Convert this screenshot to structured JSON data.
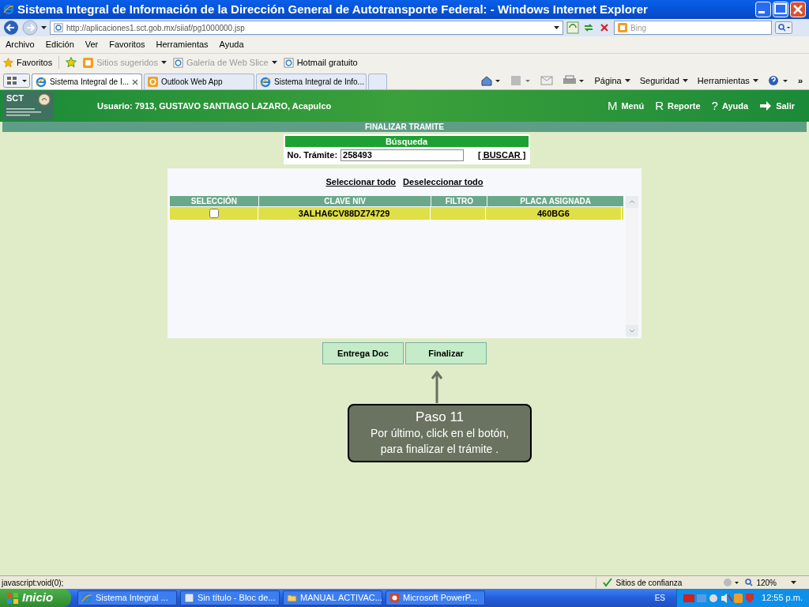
{
  "window": {
    "title": "Sistema Integral de Información de la Dirección General de Autotransporte Federal: - Windows Internet Explorer"
  },
  "address_bar": {
    "url": "http://aplicaciones1.sct.gob.mx/siiaf/pg1000000.jsp"
  },
  "search": {
    "placeholder": "Bing"
  },
  "menu": [
    "Archivo",
    "Edición",
    "Ver",
    "Favoritos",
    "Herramientas",
    "Ayuda"
  ],
  "favorites_bar": {
    "label": "Favoritos",
    "items": [
      {
        "label": "Sitios sugeridos",
        "dropdown": true,
        "disabled": true
      },
      {
        "label": "Galería de Web Slice",
        "dropdown": true,
        "disabled": true
      },
      {
        "label": "Hotmail gratuito",
        "dropdown": false,
        "disabled": false
      }
    ]
  },
  "tabs": [
    {
      "label": "Sistema Integral de I...",
      "selected": true
    },
    {
      "label": "Outlook Web App",
      "selected": false
    },
    {
      "label": "Sistema Integral de Info...",
      "selected": false
    }
  ],
  "command_bar": [
    "Página",
    "Seguridad",
    "Herramientas"
  ],
  "toolbar_overflow": "»",
  "page": {
    "logo": "SCT",
    "user": "Usuario: 7913, GUSTAVO SANTIAGO LAZARO, Acapulco",
    "nav": [
      {
        "glyph": "M",
        "label": "Menú"
      },
      {
        "glyph": "R",
        "label": "Reporte"
      },
      {
        "glyph": "?",
        "label": "Ayuda"
      },
      {
        "label": "Salir"
      }
    ],
    "section_title": "FINALIZAR TRAMITE",
    "search_box": {
      "title": "Búsqueda",
      "label": "No. Trámite:",
      "value": "258493",
      "button": "[ BUSCAR ]"
    },
    "links": [
      "Seleccionar todo",
      "Deseleccionar todo"
    ],
    "table": {
      "columns": [
        "SELECCIÓN",
        "CLAVE NIV",
        "FILTRO",
        "PLACA ASIGNADA"
      ],
      "rows": [
        {
          "checked": false,
          "highlighted": true,
          "clave_niv": "3ALHA6CV88DZ74729",
          "placa_asignada": "460BG6"
        }
      ]
    },
    "buttons": [
      "Entrega Doc",
      "Finalizar"
    ],
    "callout": {
      "title": "Paso 11",
      "lines": [
        "Por último, click en el botón,",
        "para finalizar el trámite ."
      ]
    }
  },
  "status_bar": {
    "text": "javascript:void(0);",
    "zone": "Sitios de confianza",
    "zoom": "120%"
  },
  "taskbar": {
    "start": "Inicio",
    "tasks": [
      "Sistema Integral ...",
      "Sin título - Bloc de...",
      "MANUAL ACTIVAC...",
      "Microsoft PowerP..."
    ],
    "language": "ES",
    "clock": "12:55 p.m."
  }
}
